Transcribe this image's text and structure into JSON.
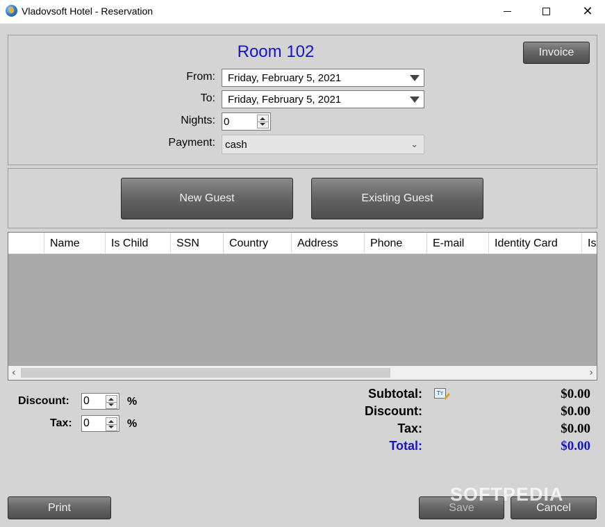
{
  "window": {
    "title": "Vladovsoft Hotel - Reservation",
    "icons": {
      "app": "hotel-globe-icon",
      "minimize": "minimize-icon",
      "maximize": "maximize-icon",
      "close": "close-icon"
    }
  },
  "reservation": {
    "room_title": "Room 102",
    "from_label": "From:",
    "from_value": "Friday, February 5, 2021",
    "to_label": "To:",
    "to_value": "Friday, February 5, 2021",
    "nights_label": "Nights:",
    "nights_value": "0",
    "payment_label": "Payment:",
    "payment_value": "cash",
    "invoice_label": "Invoice"
  },
  "guests": {
    "new_guest_label": "New Guest",
    "existing_guest_label": "Existing Guest",
    "columns": [
      "",
      "Name",
      "Is Child",
      "SSN",
      "Country",
      "Address",
      "Phone",
      "E-mail",
      "Identity Card",
      "Is"
    ],
    "rows": []
  },
  "adjustments": {
    "discount_label": "Discount:",
    "discount_value": "0",
    "tax_label": "Tax:",
    "tax_value": "0",
    "percent": "%"
  },
  "summary": {
    "subtotal_label": "Subtotal:",
    "subtotal_value": "$0.00",
    "discount_label": "Discount:",
    "discount_value": "$0.00",
    "tax_label": "Tax:",
    "tax_value": "$0.00",
    "total_label": "Total:",
    "total_value": "$0.00",
    "calc_icon": "edit-calculation-icon"
  },
  "actions": {
    "print_label": "Print",
    "save_label": "Save",
    "cancel_label": "Cancel"
  },
  "watermark": "SOFTPEDIA",
  "colors": {
    "accent_blue": "#1515c8",
    "button_dark": "#5c5c5c",
    "background": "#d4d4d4"
  }
}
